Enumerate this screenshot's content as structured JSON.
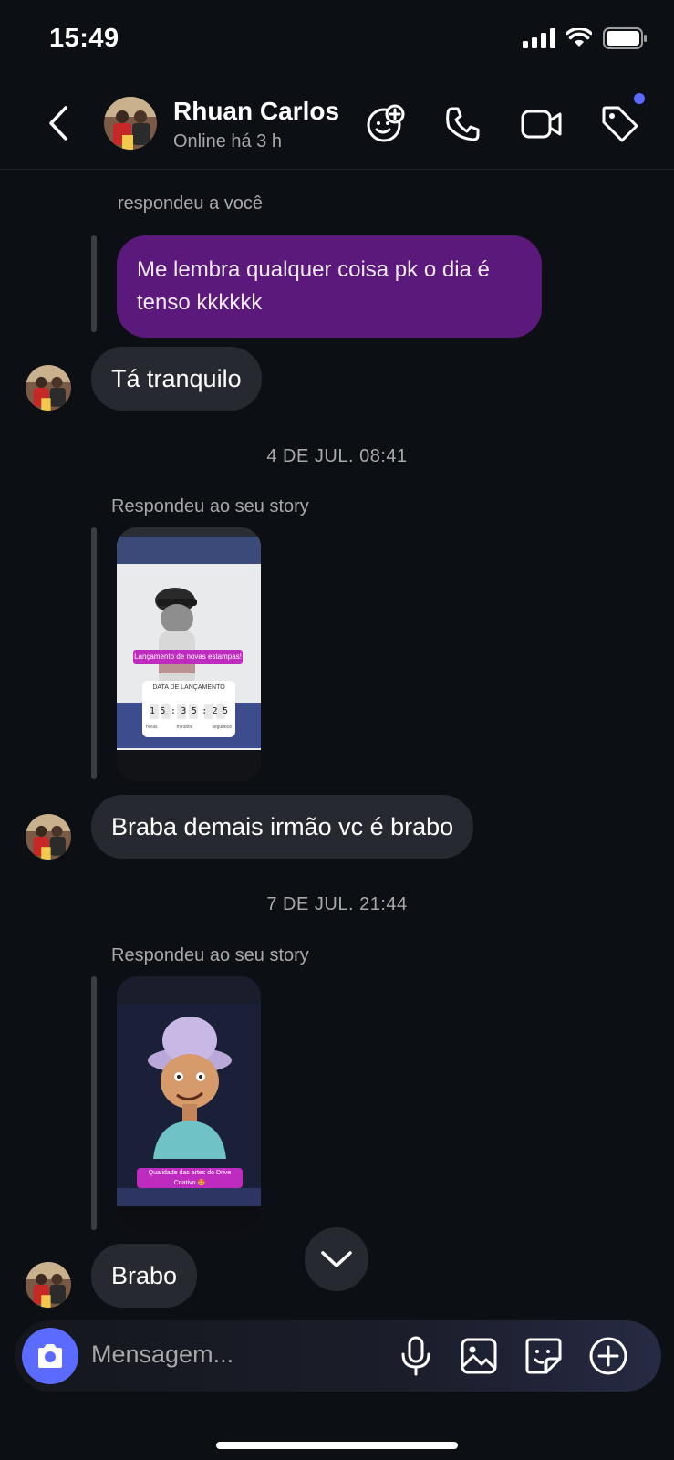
{
  "status_bar": {
    "time": "15:49"
  },
  "header": {
    "contact_name": "Rhuan Carlos",
    "contact_status": "Online há 3 h"
  },
  "messages": {
    "reply_label_1": "respondeu a você",
    "outgoing_1": "Me lembra qualquer coisa pk o dia é tenso kkkkkk",
    "incoming_1": "Tá tranquilo",
    "date_1": "4 DE JUL. 08:41",
    "story_reply_label_1": "Respondeu ao seu story",
    "story_1": {
      "sticker_text": "Lançamento de novas estampas!",
      "countdown_title": "DATA DE LANÇAMENTO",
      "countdown_digits": [
        "1",
        "5",
        ":",
        "3",
        "5",
        ":",
        "2",
        "5"
      ],
      "countdown_units": [
        "horas",
        "minutos",
        "segundos"
      ]
    },
    "incoming_2": "Braba demais irmão vc é brabo",
    "date_2": "7 DE JUL. 21:44",
    "story_reply_label_2": "Respondeu ao seu story",
    "story_2": {
      "sticker_text": "Qualidade das artes do Drive Criativo 🤩"
    },
    "incoming_3": "Brabo"
  },
  "composer": {
    "placeholder": "Mensagem..."
  },
  "colors": {
    "background": "#0c1014",
    "outgoing_bubble": "#5b1a7b",
    "incoming_bubble": "#262a30",
    "accent": "#5b6bff"
  },
  "icons": [
    "back-icon",
    "sticker-add-icon",
    "phone-icon",
    "video-icon",
    "tag-icon",
    "camera-icon",
    "microphone-icon",
    "gallery-icon",
    "sticker-icon",
    "plus-icon",
    "chevron-down-icon"
  ]
}
